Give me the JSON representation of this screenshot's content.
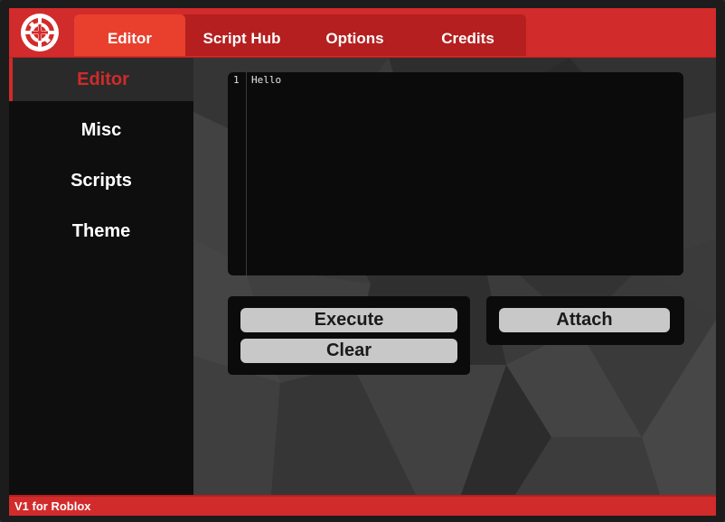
{
  "header": {
    "logo_icon": "crosshair-logo-icon",
    "tabs": [
      {
        "label": "Editor",
        "active": true
      },
      {
        "label": "Script Hub",
        "active": false
      },
      {
        "label": "Options",
        "active": false
      },
      {
        "label": "Credits",
        "active": false
      }
    ]
  },
  "sidebar": {
    "items": [
      {
        "label": "Editor",
        "active": true
      },
      {
        "label": "Misc",
        "active": false
      },
      {
        "label": "Scripts",
        "active": false
      },
      {
        "label": "Theme",
        "active": false
      }
    ]
  },
  "editor": {
    "line_numbers": [
      "1"
    ],
    "code": "Hello"
  },
  "actions": {
    "execute_label": "Execute",
    "clear_label": "Clear",
    "attach_label": "Attach"
  },
  "status": {
    "text": "V1 for Roblox"
  },
  "colors": {
    "accent": "#d22b2b",
    "accent_active_tab": "#e8402d",
    "sidebar_bg": "#0e0e0e",
    "editor_bg": "#0b0b0b",
    "button_bg": "#c8c8c8"
  }
}
